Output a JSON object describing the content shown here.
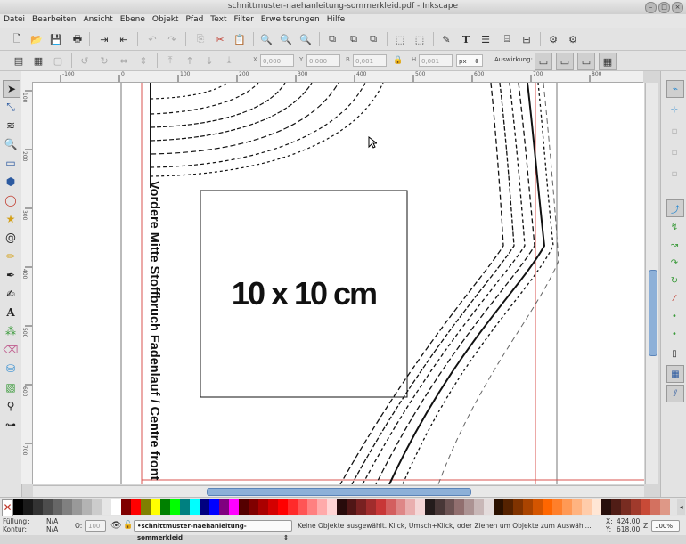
{
  "window": {
    "title": "schnittmuster-naehanleitung-sommerkleid.pdf - Inkscape",
    "controls": [
      "–",
      "□",
      "×"
    ]
  },
  "menubar": [
    "Datei",
    "Bearbeiten",
    "Ansicht",
    "Ebene",
    "Objekt",
    "Pfad",
    "Text",
    "Filter",
    "Erweiterungen",
    "Hilfe"
  ],
  "toolcontrols": {
    "x_label": "X",
    "x_value": "0,000",
    "y_label": "Y",
    "y_value": "0,000",
    "w_label": "B",
    "w_value": "0,001",
    "h_label": "H",
    "h_value": "0,001",
    "unit": "px",
    "affect_label": "Auswirkung:"
  },
  "ruler": {
    "h_ticks": [
      "-100",
      "0",
      "100",
      "200",
      "300",
      "400",
      "500",
      "600",
      "700",
      "800"
    ],
    "v_ticks": [
      "100",
      "200",
      "300",
      "400",
      "500",
      "600",
      "700",
      "800"
    ]
  },
  "canvas": {
    "box_label": "10 x 10 cm",
    "vertical_text": "Vordere Mitte Stoffbruch Fadenlauf / Centre front on"
  },
  "colors": {
    "guide_red": "#d9534f",
    "ink": "#111111",
    "selection_blue": "#4a90d9"
  },
  "statusbar": {
    "fill_label": "Füllung:",
    "fill_value": "N/A",
    "stroke_label": "Kontur:",
    "stroke_value": "N/A",
    "opacity_label": "O:",
    "opacity_value": "100",
    "layer": "•schnittmuster-naehanleitung-sommerkleid",
    "message": "Keine Objekte ausgewählt. Klick, Umsch+Klick, oder Ziehen um Objekte zum Auswähl...",
    "x_label": "X:",
    "x_coord": "424,00",
    "y_label": "Y:",
    "y_coord": "618,00",
    "zoom_label": "Z:",
    "zoom": "100%"
  }
}
